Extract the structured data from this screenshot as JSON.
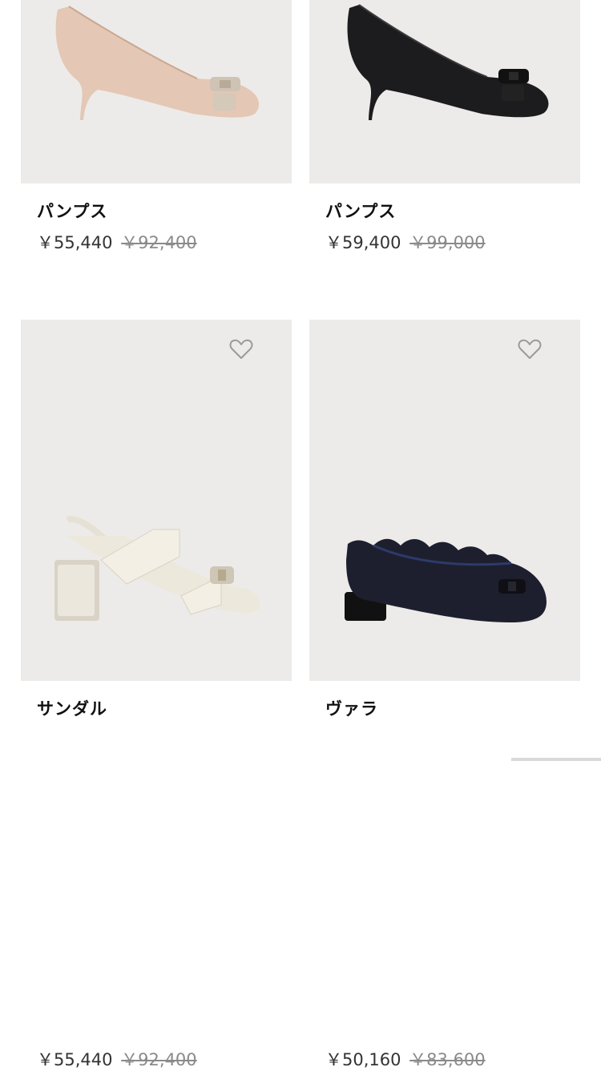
{
  "products": [
    {
      "name": "パンプス",
      "price": "￥55,440",
      "original_price": "￥92,400",
      "image": "nude-patent-bow-pump",
      "color": "#e4c7b4"
    },
    {
      "name": "パンプス",
      "price": "￥59,400",
      "original_price": "￥99,000",
      "image": "black-bow-pump",
      "color": "#1c1c1e"
    },
    {
      "name": "サンダル",
      "price": "￥55,440",
      "original_price": "￥92,400",
      "image": "white-patent-bow-sandal",
      "color": "#ece8dc",
      "icon": "heart-outline-icon"
    },
    {
      "name": "ヴァラ",
      "price": "￥50,160",
      "original_price": "￥83,600",
      "image": "navy-scalloped-bow-flat",
      "color": "#1d1f2e",
      "icon": "heart-outline-icon"
    }
  ],
  "colors": {
    "image_bg": "#ecebe9",
    "text": "#111111",
    "muted": "#8a8a8a"
  }
}
